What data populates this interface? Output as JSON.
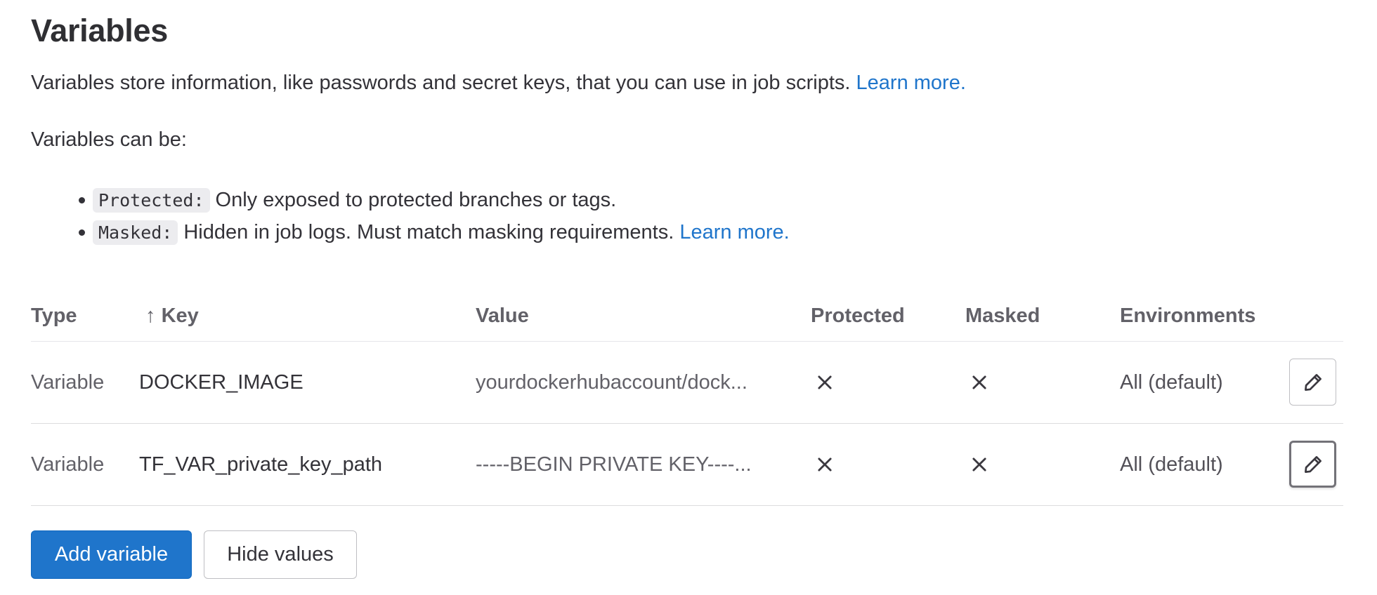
{
  "header": {
    "title": "Variables",
    "description": "Variables store information, like passwords and secret keys, that you can use in job scripts.",
    "learn_more": "Learn more.",
    "can_be": "Variables can be:"
  },
  "bullets": [
    {
      "code": "Protected:",
      "text": "Only exposed to protected branches or tags.",
      "link": ""
    },
    {
      "code": "Masked:",
      "text": "Hidden in job logs. Must match masking requirements.",
      "link": "Learn more."
    }
  ],
  "table": {
    "sort_indicator": "↑",
    "columns": {
      "type": "Type",
      "key": "Key",
      "value": "Value",
      "protected": "Protected",
      "masked": "Masked",
      "environments": "Environments"
    },
    "rows": [
      {
        "type": "Variable",
        "key": "DOCKER_IMAGE",
        "value": "yourdockerhubaccount/dock...",
        "protected_icon": "close-icon",
        "masked_icon": "close-icon",
        "environments": "All (default)",
        "edit_icon": "pencil-icon"
      },
      {
        "type": "Variable",
        "key": "TF_VAR_private_key_path",
        "value": "-----BEGIN PRIVATE KEY----...",
        "protected_icon": "close-icon",
        "masked_icon": "close-icon",
        "environments": "All (default)",
        "edit_icon": "pencil-icon"
      }
    ]
  },
  "actions": {
    "add_variable": "Add variable",
    "hide_values": "Hide values"
  },
  "colors": {
    "primary": "#1f75cb",
    "link": "#1f75cb",
    "text": "#333238",
    "muted": "#626168",
    "border": "#dcdcde"
  }
}
